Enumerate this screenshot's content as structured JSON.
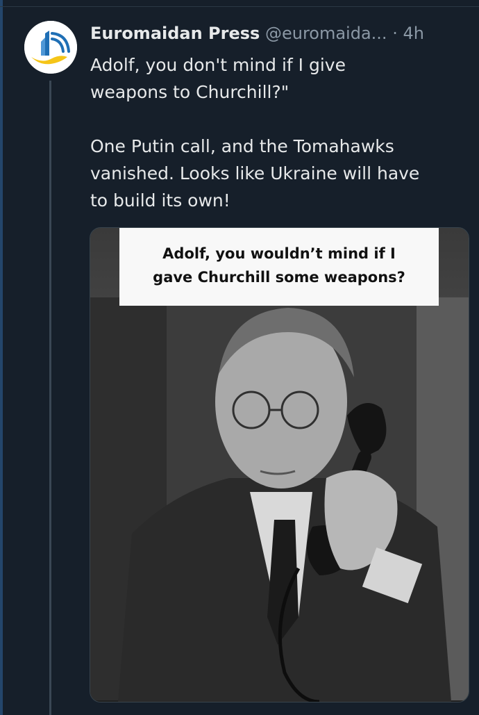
{
  "tweet": {
    "display_name": "Euromaidan Press",
    "handle": "@euromaida...",
    "separator": "·",
    "timestamp": "4h",
    "text": "Adolf, you don't mind if I give\nweapons to Churchill?\"\n\nOne Putin call, and the Tomahawks\nvanished. Looks like Ukraine will have\nto build its own!"
  },
  "media": {
    "caption": "Adolf, you wouldn’t mind if I\ngave Churchill some weapons?"
  },
  "colors": {
    "background": "#161f2a",
    "text_primary": "#e7e9ea",
    "text_secondary": "#8b98a5",
    "logo_blue": "#1f6fb5",
    "logo_yellow": "#f5c518"
  },
  "icons": {
    "avatar": "euromaidan-press-logo"
  }
}
